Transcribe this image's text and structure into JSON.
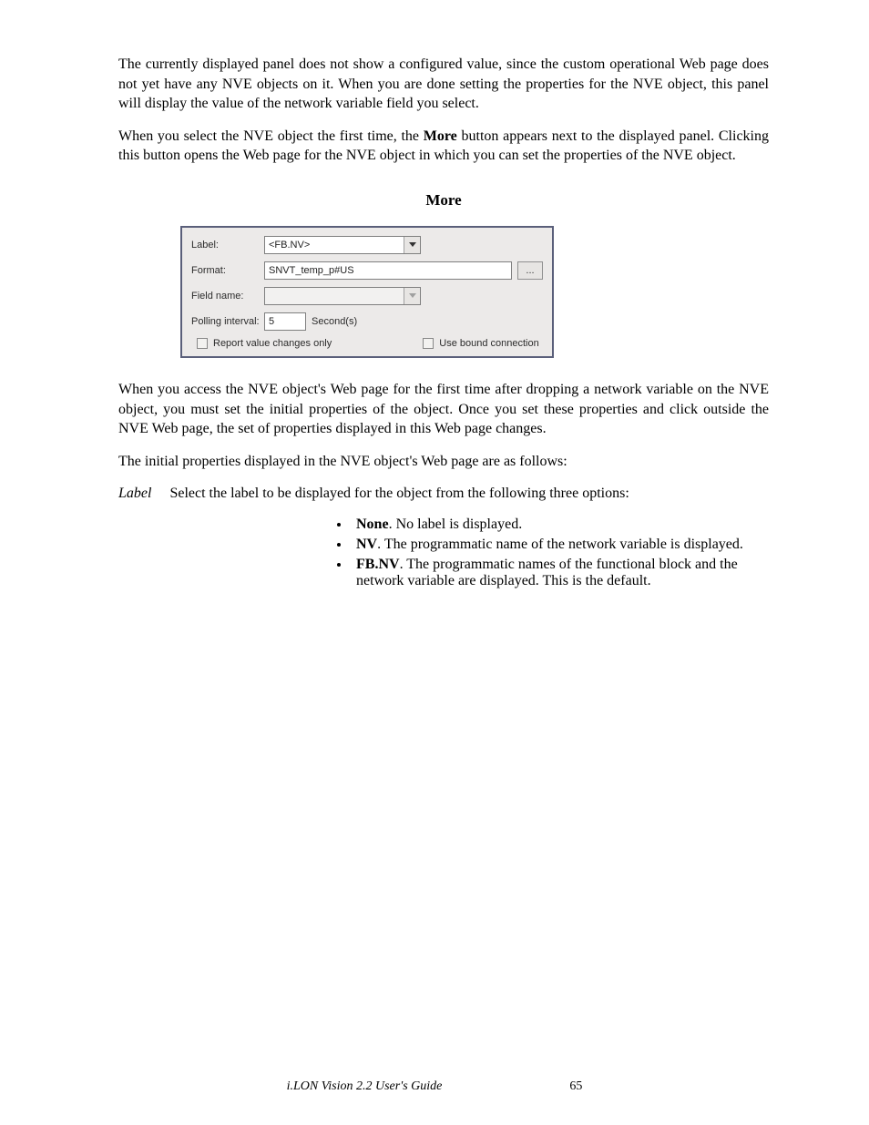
{
  "body": {
    "p1": "The currently displayed panel does not show a configured value, since the custom operational Web page does not yet have any NVE objects on it. When you are done setting the properties for the NVE object, this panel will display the value of the network variable field you select.",
    "p2_a": "When you select the NVE object the first time, the ",
    "p2_more": "More",
    "p2_b": " button appears next to the displayed panel. Clicking this button opens the Web page for the NVE object in which you can set the properties of the NVE object."
  },
  "section_heading": "More",
  "panel": {
    "labels": {
      "label": "Label:",
      "format": "Format:",
      "field": "Field name:",
      "poll": "Polling interval:",
      "poll_unit": "Second(s)"
    },
    "values": {
      "label": "<FB.NV>",
      "format": "SNVT_temp_p#US",
      "field": "",
      "poll": "5"
    },
    "browse": "...",
    "check1": "Report value changes only",
    "check2": "Use bound connection"
  },
  "after_panel": {
    "p3": "When you access the NVE object's Web page for the first time after dropping a network variable on the NVE object, you must set the initial properties of the object. Once you set these properties and click outside the NVE Web page, the set of properties displayed in this Web page changes.",
    "p4": "The initial properties displayed in the NVE object's Web page are as follows:",
    "field_label": "Label",
    "field_desc": "Select the label to be displayed for the object from the following three options:",
    "items": [
      {
        "term": "None",
        "desc": ". No label is displayed."
      },
      {
        "term": "NV",
        "desc": ". The programmatic name of the network variable is displayed."
      },
      {
        "term": "FB.NV",
        "desc": ". The programmatic names of the functional block and the network variable are displayed. This is the default."
      }
    ]
  },
  "footer": {
    "title": "i.LON Vision 2.2 User's Guide",
    "page": "65"
  }
}
